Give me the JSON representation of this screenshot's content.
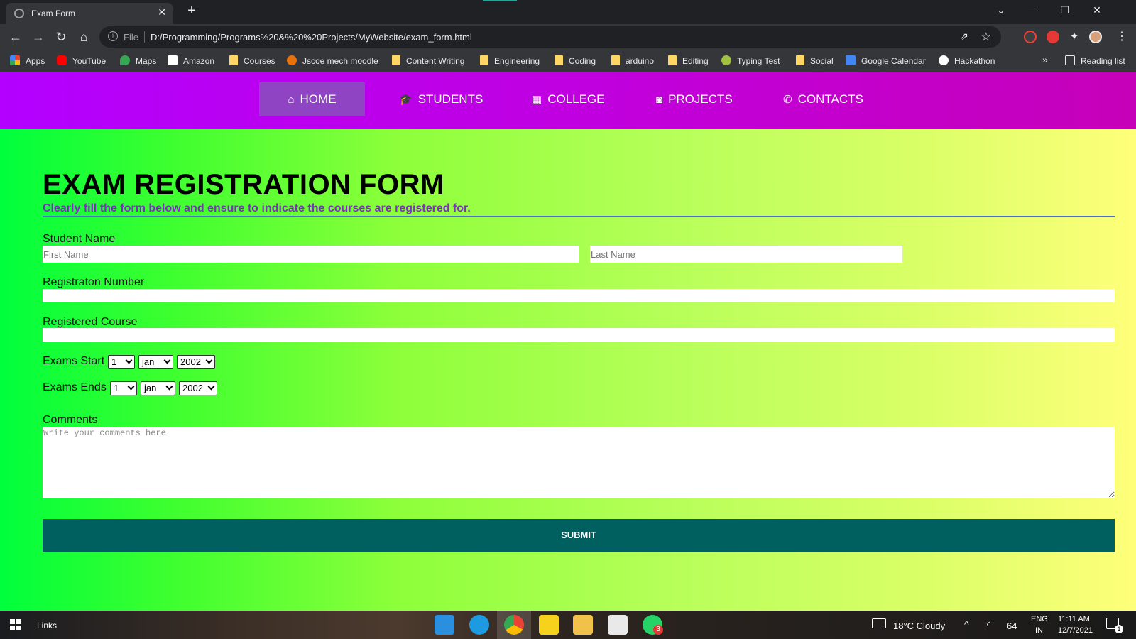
{
  "browser": {
    "tab_title": "Exam Form",
    "tab_close": "✕",
    "new_tab": "+",
    "scheme": "File",
    "url": "D:/Programming/Programs%20&%20%20Projects/MyWebsite/exam_form.html",
    "window_controls": [
      "⌄",
      "—",
      "❐",
      "✕"
    ]
  },
  "bookmarks": [
    {
      "label": "Apps",
      "icon": "apps-grid-icon",
      "color": "#ea4335"
    },
    {
      "label": "YouTube",
      "icon": "youtube-icon",
      "color": "#ff0000"
    },
    {
      "label": "Maps",
      "icon": "maps-pin-icon",
      "color": "#34a853"
    },
    {
      "label": "Amazon",
      "icon": "amazon-icon",
      "color": "#ffffff"
    },
    {
      "label": "Courses",
      "icon": "folder-icon",
      "color": "#fdd663"
    },
    {
      "label": "Jscoe mech moodle",
      "icon": "moodle-icon",
      "color": "#e8710a"
    },
    {
      "label": "Content Writing",
      "icon": "folder-icon",
      "color": "#fdd663"
    },
    {
      "label": "Engineering",
      "icon": "folder-icon",
      "color": "#fdd663"
    },
    {
      "label": "Coding",
      "icon": "folder-icon",
      "color": "#fdd663"
    },
    {
      "label": "arduino",
      "icon": "folder-icon",
      "color": "#fdd663"
    },
    {
      "label": "Editing",
      "icon": "folder-icon",
      "color": "#fdd663"
    },
    {
      "label": "Typing Test",
      "icon": "typing-test-icon",
      "color": "#a0c040"
    },
    {
      "label": "Social",
      "icon": "folder-icon",
      "color": "#fdd663"
    },
    {
      "label": "Google Calendar",
      "icon": "calendar-icon",
      "color": "#4285f4"
    },
    {
      "label": "Hackathon",
      "icon": "hackathon-icon",
      "color": "#ffffff"
    }
  ],
  "bookmarks_overflow": "»",
  "reading_list": "Reading list",
  "nav": [
    {
      "label": "HOME",
      "icon": "home-icon",
      "glyph": "⌂",
      "active": true
    },
    {
      "label": "STUDENTS",
      "icon": "graduation-cap-icon",
      "glyph": "🎓",
      "active": false
    },
    {
      "label": "COLLEGE",
      "icon": "building-icon",
      "glyph": "▦",
      "active": false
    },
    {
      "label": "PROJECTS",
      "icon": "camera-icon",
      "glyph": "◙",
      "active": false
    },
    {
      "label": "CONTACTS",
      "icon": "phone-icon",
      "glyph": "✆",
      "active": false
    }
  ],
  "form": {
    "title": "EXAM REGISTRATION FORM",
    "subtitle": "Clearly fill the form below and ensure to indicate the courses are registered for.",
    "student_name_label": "Student Name",
    "first_name_placeholder": "First Name",
    "last_name_placeholder": "Last Name",
    "reg_number_label": "Registraton Number",
    "course_label": "Registered Course",
    "exams_start_label": "Exams Start",
    "exams_end_label": "Exams Ends",
    "start_day": "1",
    "start_month": "jan",
    "start_year": "2002",
    "end_day": "1",
    "end_month": "jan",
    "end_year": "2002",
    "comments_label": "Comments",
    "comments_placeholder": "Write your comments here",
    "submit_label": "SUBMIT"
  },
  "taskbar": {
    "links_label": "Links",
    "weather": "18°C  Cloudy",
    "battery": "64",
    "lang_top": "ENG",
    "lang_bottom": "IN",
    "time": "11:11 AM",
    "date": "12/7/2021",
    "whatsapp_badge": "3",
    "notification_count": "1",
    "apps": [
      {
        "name": "mail-icon",
        "color": "#2b8fe0"
      },
      {
        "name": "edge-icon",
        "color": "#1e9be0"
      },
      {
        "name": "chrome-icon",
        "color": "#e8453c"
      },
      {
        "name": "sticky-notes-icon",
        "color": "#f7d21d"
      },
      {
        "name": "file-explorer-icon",
        "color": "#f2c14a"
      },
      {
        "name": "store-icon",
        "color": "#e9e9e9"
      },
      {
        "name": "whatsapp-icon",
        "color": "#25d366"
      }
    ]
  }
}
